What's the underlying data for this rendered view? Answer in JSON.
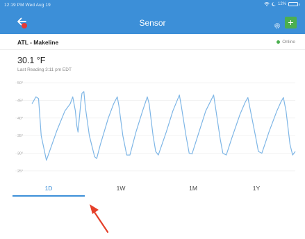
{
  "status_bar": {
    "time": "12:19 PM  Wed Aug 19",
    "battery": "12%"
  },
  "header": {
    "title": "Sensor",
    "back_icon": "back-arrow-icon",
    "settings_icon": "gear-icon",
    "add_label": "+"
  },
  "sensor": {
    "location": "ATL - Makeline",
    "status": "Online",
    "reading": "30.1 °F",
    "last_reading": "Last Reading 3:11 pm EDT"
  },
  "colors": {
    "header": "#3c8fd8",
    "accent": "#3c8fd8",
    "online": "#4caf50",
    "add_button": "#4caf50",
    "badge": "#e53935",
    "annotation_arrow": "#e5402a"
  },
  "tabs": [
    {
      "label": "1D",
      "active": true
    },
    {
      "label": "1W",
      "active": false
    },
    {
      "label": "1M",
      "active": false
    },
    {
      "label": "1Y",
      "active": false
    }
  ],
  "chart_data": {
    "type": "line",
    "y_tick_labels": [
      "50°",
      "45°",
      "40°",
      "35°",
      "30°",
      "25°"
    ],
    "y_ticks": [
      50,
      45,
      40,
      35,
      30,
      25
    ],
    "ylim": [
      24,
      51
    ],
    "xlim": [
      0,
      1
    ],
    "grid": true,
    "series": [
      {
        "color": "#7eb6e6",
        "points": [
          [
            0.0,
            44.0
          ],
          [
            0.015,
            46.0
          ],
          [
            0.025,
            45.5
          ],
          [
            0.035,
            35.0
          ],
          [
            0.055,
            28.0
          ],
          [
            0.095,
            36.5
          ],
          [
            0.125,
            42.0
          ],
          [
            0.145,
            44.0
          ],
          [
            0.155,
            46.0
          ],
          [
            0.165,
            42.0
          ],
          [
            0.17,
            38.0
          ],
          [
            0.175,
            36.0
          ],
          [
            0.185,
            44.0
          ],
          [
            0.19,
            47.0
          ],
          [
            0.197,
            47.5
          ],
          [
            0.203,
            43.0
          ],
          [
            0.218,
            35.0
          ],
          [
            0.238,
            29.0
          ],
          [
            0.246,
            28.5
          ],
          [
            0.26,
            32.5
          ],
          [
            0.29,
            40.0
          ],
          [
            0.31,
            44.0
          ],
          [
            0.324,
            46.0
          ],
          [
            0.33,
            43.5
          ],
          [
            0.345,
            35.0
          ],
          [
            0.36,
            29.5
          ],
          [
            0.372,
            29.5
          ],
          [
            0.395,
            36.0
          ],
          [
            0.42,
            42.0
          ],
          [
            0.438,
            46.0
          ],
          [
            0.445,
            44.0
          ],
          [
            0.46,
            35.0
          ],
          [
            0.47,
            30.5
          ],
          [
            0.48,
            29.5
          ],
          [
            0.51,
            36.0
          ],
          [
            0.535,
            42.0
          ],
          [
            0.56,
            46.5
          ],
          [
            0.567,
            43.5
          ],
          [
            0.585,
            35.0
          ],
          [
            0.597,
            30.0
          ],
          [
            0.608,
            29.8
          ],
          [
            0.63,
            35.0
          ],
          [
            0.66,
            42.0
          ],
          [
            0.69,
            46.5
          ],
          [
            0.697,
            43.0
          ],
          [
            0.715,
            34.0
          ],
          [
            0.725,
            30.0
          ],
          [
            0.738,
            29.5
          ],
          [
            0.76,
            34.5
          ],
          [
            0.79,
            41.0
          ],
          [
            0.81,
            44.5
          ],
          [
            0.82,
            45.8
          ],
          [
            0.83,
            42.0
          ],
          [
            0.85,
            34.5
          ],
          [
            0.86,
            30.5
          ],
          [
            0.873,
            30.0
          ],
          [
            0.9,
            36.0
          ],
          [
            0.93,
            42.0
          ],
          [
            0.945,
            44.5
          ],
          [
            0.955,
            45.8
          ],
          [
            0.965,
            42.0
          ],
          [
            0.98,
            32.5
          ],
          [
            0.99,
            29.5
          ],
          [
            1.0,
            30.5
          ]
        ]
      }
    ]
  }
}
